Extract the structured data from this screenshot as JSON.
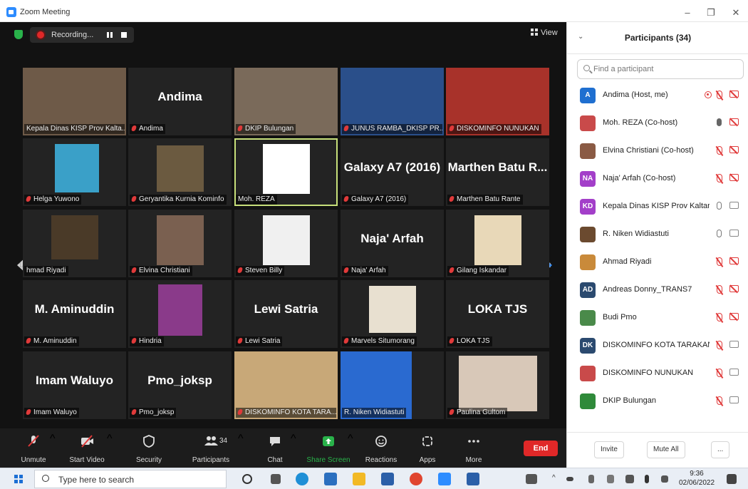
{
  "window": {
    "title": "Zoom Meeting",
    "minimize": "–",
    "restore": "❐",
    "close": "✕"
  },
  "topbar": {
    "recording_label": "Recording...",
    "view_label": "View"
  },
  "gallery": {
    "page_left": "1/2",
    "page_right": "1/2",
    "tiles": [
      {
        "label": "Kepala Dinas KISP Prov Kalta...",
        "big": "",
        "muted": false
      },
      {
        "label": "Andima",
        "big": "Andima",
        "muted": true
      },
      {
        "label": "DKIP Bulungan",
        "big": "",
        "muted": true
      },
      {
        "label": "JUNUS RAMBA_DKISP PR...",
        "big": "",
        "muted": true
      },
      {
        "label": "DISKOMINFO NUNUKAN",
        "big": "",
        "muted": true
      },
      {
        "label": "Helga Yuwono",
        "big": "",
        "muted": true
      },
      {
        "label": "Geryantika Kurnia Kominfo",
        "big": "",
        "muted": true
      },
      {
        "label": "Moh. REZA",
        "big": "",
        "muted": false
      },
      {
        "label": "Galaxy A7 (2016)",
        "big": "Galaxy A7 (2016)",
        "muted": true
      },
      {
        "label": "Marthen Batu Rante",
        "big": "Marthen Batu R...",
        "muted": true
      },
      {
        "label": "hmad Riyadi",
        "big": "",
        "muted": false
      },
      {
        "label": "Elvina Christiani",
        "big": "",
        "muted": true
      },
      {
        "label": "Steven Billy",
        "big": "",
        "muted": true
      },
      {
        "label": "Naja' Arfah",
        "big": "Naja' Arfah",
        "muted": true
      },
      {
        "label": "Gilang Iskandar",
        "big": "",
        "muted": true
      },
      {
        "label": "M. Aminuddin",
        "big": "M. Aminuddin",
        "muted": true
      },
      {
        "label": "Hindria",
        "big": "",
        "muted": true
      },
      {
        "label": "Lewi Satria",
        "big": "Lewi Satria",
        "muted": true
      },
      {
        "label": "Marvels Situmorang",
        "big": "",
        "muted": true
      },
      {
        "label": "LOKA TJS",
        "big": "LOKA TJS",
        "muted": true
      },
      {
        "label": "Imam Waluyo",
        "big": "Imam Waluyo",
        "muted": true
      },
      {
        "label": "Pmo_joksp",
        "big": "Pmo_joksp",
        "muted": true
      },
      {
        "label": "DISKOMINFO KOTA TARA...",
        "big": "",
        "muted": true
      },
      {
        "label": "R. Niken Widiastuti",
        "big": "",
        "muted": false
      },
      {
        "label": "Paulina Gultom",
        "big": "",
        "muted": true
      }
    ]
  },
  "toolbar": {
    "unmute": "Unmute",
    "start_video": "Start Video",
    "security": "Security",
    "participants": "Participants",
    "participants_count": "34",
    "chat": "Chat",
    "share_screen": "Share Screen",
    "reactions": "Reactions",
    "apps": "Apps",
    "more": "More",
    "end": "End",
    "share_color": "#29b24a",
    "end_color": "#e02828"
  },
  "panel": {
    "title": "Participants (34)",
    "search_placeholder": "Find a participant",
    "invite": "Invite",
    "mute_all": "Mute All",
    "more": "...",
    "participants": [
      {
        "name": "Andima (Host, me)",
        "initials": "A",
        "color": "#1f6fd0",
        "mic": "muted",
        "cam": "off",
        "rec": true
      },
      {
        "name": "Moh. REZA (Co-host)",
        "initials": "",
        "color": "#c94a4a",
        "mic": "active",
        "cam": "off",
        "rec": false
      },
      {
        "name": "Elvina Christiani (Co-host)",
        "initials": "",
        "color": "#8a5a44",
        "mic": "muted",
        "cam": "off",
        "rec": false
      },
      {
        "name": "Naja' Arfah (Co-host)",
        "initials": "NA",
        "color": "#a33fc9",
        "mic": "muted",
        "cam": "off",
        "rec": false
      },
      {
        "name": "Kepala Dinas KISP Prov Kaltara",
        "initials": "KD",
        "color": "#a33fc9",
        "mic": "on",
        "cam": "on",
        "rec": false
      },
      {
        "name": "R. Niken Widiastuti",
        "initials": "",
        "color": "#6b4a2f",
        "mic": "on",
        "cam": "on",
        "rec": false
      },
      {
        "name": "Ahmad Riyadi",
        "initials": "",
        "color": "#c98a3a",
        "mic": "muted",
        "cam": "off",
        "rec": false
      },
      {
        "name": "Andreas Donny_TRANS7",
        "initials": "AD",
        "color": "#2b4a6f",
        "mic": "muted",
        "cam": "off",
        "rec": false
      },
      {
        "name": "Budi Pmo",
        "initials": "",
        "color": "#4a8a4a",
        "mic": "muted",
        "cam": "off",
        "rec": false
      },
      {
        "name": "DISKOMINFO KOTA TARAKAN",
        "initials": "DK",
        "color": "#2b4a6f",
        "mic": "muted",
        "cam": "on",
        "rec": false
      },
      {
        "name": "DISKOMINFO NUNUKAN",
        "initials": "",
        "color": "#c94a4a",
        "mic": "muted",
        "cam": "on",
        "rec": false
      },
      {
        "name": "DKIP Bulungan",
        "initials": "",
        "color": "#2f8a3a",
        "mic": "muted",
        "cam": "on",
        "rec": false
      }
    ]
  },
  "taskbar": {
    "search_text": "Type here to search",
    "time": "9:36",
    "date": "02/06/2022"
  }
}
